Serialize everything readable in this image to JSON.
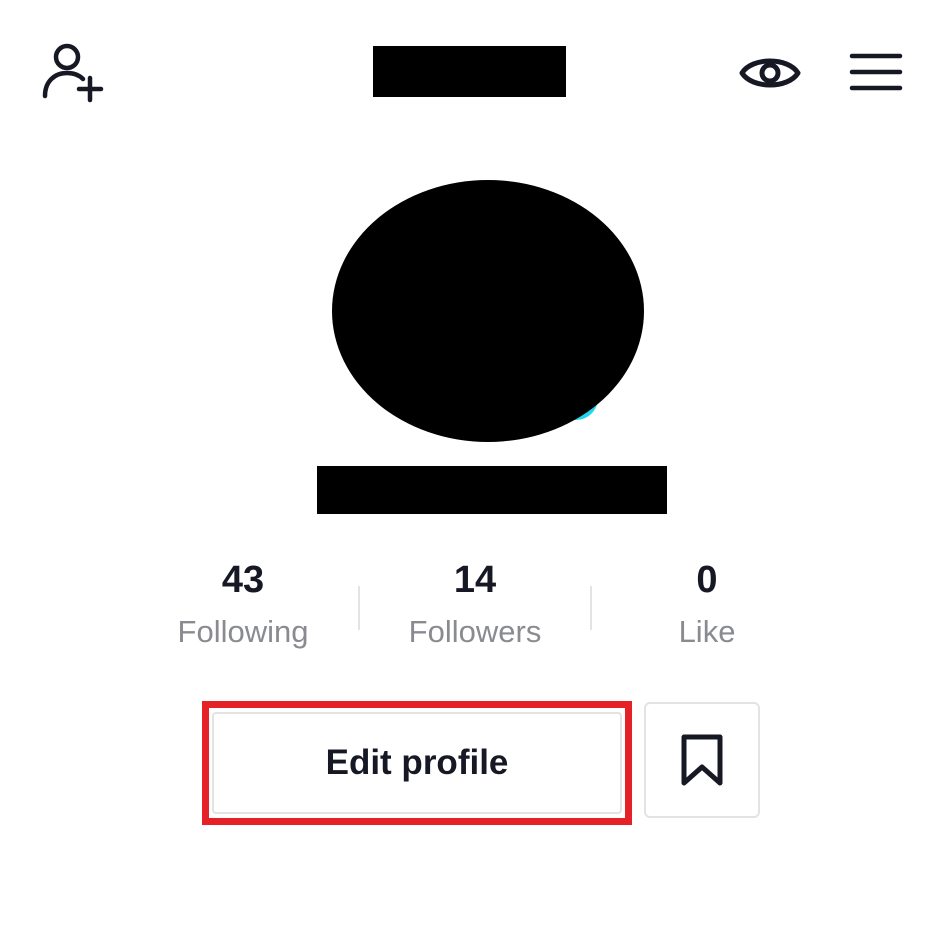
{
  "header": {
    "add_friend_icon": "add-user-icon",
    "view_icon": "eye-icon",
    "menu_icon": "hamburger-menu-icon"
  },
  "stats": [
    {
      "value": "43",
      "label": "Following"
    },
    {
      "value": "14",
      "label": "Followers"
    },
    {
      "value": "0",
      "label": "Like"
    }
  ],
  "actions": {
    "edit_profile_label": "Edit profile",
    "bookmark_icon": "bookmark-icon"
  },
  "colors": {
    "text_primary": "#161823",
    "text_secondary": "#8a8b91",
    "border": "#e3e3e4",
    "highlight": "#e52127",
    "accent_cyan": "#20d5ec"
  }
}
